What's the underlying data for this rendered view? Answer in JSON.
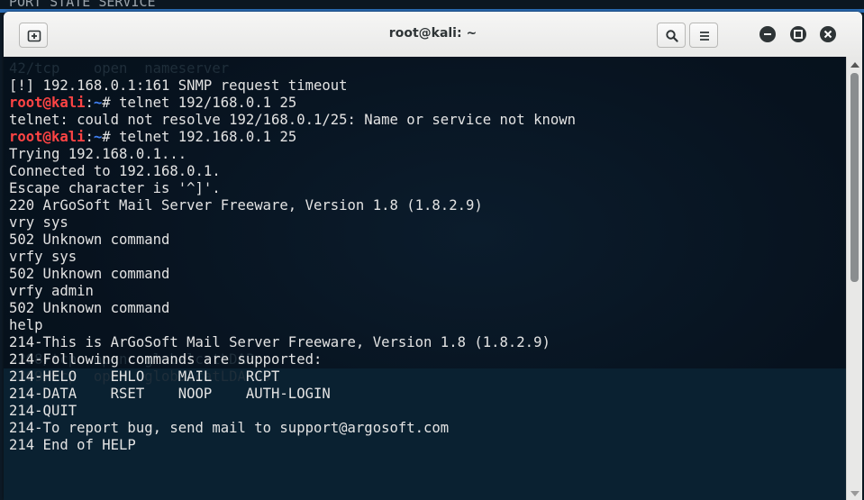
{
  "background_terminal": {
    "text": "PORT      STATE SERVICE"
  },
  "window": {
    "title": "root@kali: ~"
  },
  "icons": {
    "new_tab": "new-tab-icon",
    "search": "search-icon",
    "menu": "hamburger-menu-icon",
    "minimize": "minimize-icon",
    "maximize": "maximize-icon",
    "close": "close-icon"
  },
  "colors": {
    "prompt_user": "#ff4444",
    "prompt_path": "#3f7ff0",
    "text": "#e3e3e3",
    "background": "#07121e"
  },
  "ghost_lines": [
    "42/tcp    open  nameserver",
    "3268/tcp  open  globalcatLDAP",
    "3269/tcp  open  globalcatLDAPssl"
  ],
  "terminal": {
    "prompt": {
      "user": "root@kali",
      "sep": ":",
      "path": "~",
      "symbol": "# "
    },
    "lines": [
      {
        "text": "[!] 192.168.0.1:161 SNMP request timeout"
      },
      {
        "prompt": true,
        "text": "telnet 192/168.0.1 25"
      },
      {
        "text": "telnet: could not resolve 192/168.0.1/25: Name or service not known"
      },
      {
        "prompt": true,
        "text": "telnet 192.168.0.1 25"
      },
      {
        "text": "Trying 192.168.0.1..."
      },
      {
        "text": "Connected to 192.168.0.1."
      },
      {
        "text": "Escape character is '^]'."
      },
      {
        "text": "220 ArGoSoft Mail Server Freeware, Version 1.8 (1.8.2.9)"
      },
      {
        "text": "vry sys"
      },
      {
        "text": "502 Unknown command"
      },
      {
        "text": "vrfy sys"
      },
      {
        "text": "502 Unknown command"
      },
      {
        "text": "vrfy admin"
      },
      {
        "text": "502 Unknown command"
      },
      {
        "text": "help"
      },
      {
        "text": "214-This is ArGoSoft Mail Server Freeware, Version 1.8 (1.8.2.9)"
      },
      {
        "text": "214-Following commands are supported:"
      },
      {
        "text": "214-HELO    EHLO    MAIL    RCPT"
      },
      {
        "text": "214-DATA    RSET    NOOP    AUTH-LOGIN"
      },
      {
        "text": "214-QUIT"
      },
      {
        "text": "214-To report bug, send mail to support@argosoft.com"
      },
      {
        "text": "214 End of HELP"
      }
    ]
  }
}
